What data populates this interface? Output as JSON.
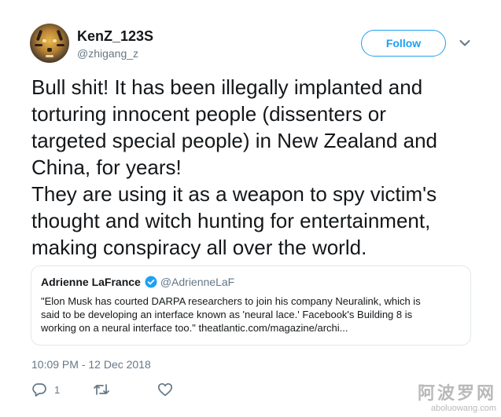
{
  "author": {
    "display_name": "KenZ_123S",
    "handle": "@zhigang_z",
    "follow_label": "Follow"
  },
  "tweet": {
    "lines": [
      "Bull shit! It has been illegally implanted and",
      "torturing innocent people (dissenters or",
      "targeted special people) in New Zealand and",
      "China, for years!",
      "They are using it as a weapon to spy victim's",
      "thought and witch hunting for entertainment,",
      "making conspiracy all over the world."
    ],
    "timestamp": "10:09 PM - 12 Dec 2018"
  },
  "quoted_tweet": {
    "name": "Adrienne LaFrance",
    "handle": "@AdrienneLaF",
    "lines": [
      "\"Elon Musk has courted DARPA researchers to join his company Neuralink, which is",
      "said to be developing an interface known as 'neural lace.' Facebook's Building 8 is",
      "working on a neural interface too.\" theatlantic.com/magazine/archi..."
    ]
  },
  "actions": {
    "reply_count": "1",
    "retweet_count": "",
    "like_count": ""
  },
  "watermark": {
    "title": "阿波罗网",
    "site": "aboluowang.com"
  },
  "colors": {
    "accent": "#1da1f2",
    "muted": "#657786",
    "text": "#14171a",
    "border": "#e1e8ed"
  }
}
